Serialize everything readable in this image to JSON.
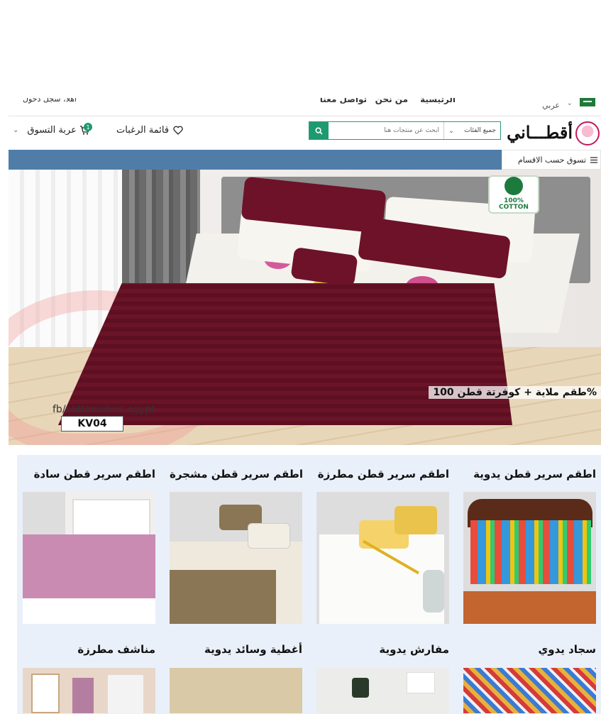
{
  "top": {
    "language": "عربي",
    "nav_home": "الرئيسية",
    "nav_about": "من نحن",
    "nav_contact": "تواصل معنا",
    "account": "اهلا، سجل دخول"
  },
  "header": {
    "logo_text": "أقطـــاني",
    "search_placeholder": "ابحث عن منتجات هنا",
    "search_category": "جميع الفئات",
    "wishlist_label": "قائمة الرغبات",
    "cart_label": "عربة التسوق",
    "cart_count": "1"
  },
  "nav": {
    "all_categories": "تسوق حسب الاقسام"
  },
  "hero": {
    "badge_line1": "100%",
    "badge_line2": "COTTON",
    "caption": "طقم ملاية + كوفرتة قطن 100%",
    "source": "fb/cottonvibes.egypt",
    "code": "KV04"
  },
  "categories": [
    {
      "title": "اطقم سرير قطن يدوية"
    },
    {
      "title": "اطقم سرير قطن مطرزة"
    },
    {
      "title": "اطقم سرير قطن مشجرة"
    },
    {
      "title": "اطقم سرير قطن سادة"
    },
    {
      "title": "سجاد يدوي"
    },
    {
      "title": "مفارش يدوية"
    },
    {
      "title": "أغطية وسائد يدوية"
    },
    {
      "title": "مناشف مطرزة"
    }
  ],
  "colors": {
    "accent_green": "#1e9a70",
    "nav_blue": "#4f7da8",
    "section_bg": "#eaf0fa"
  }
}
